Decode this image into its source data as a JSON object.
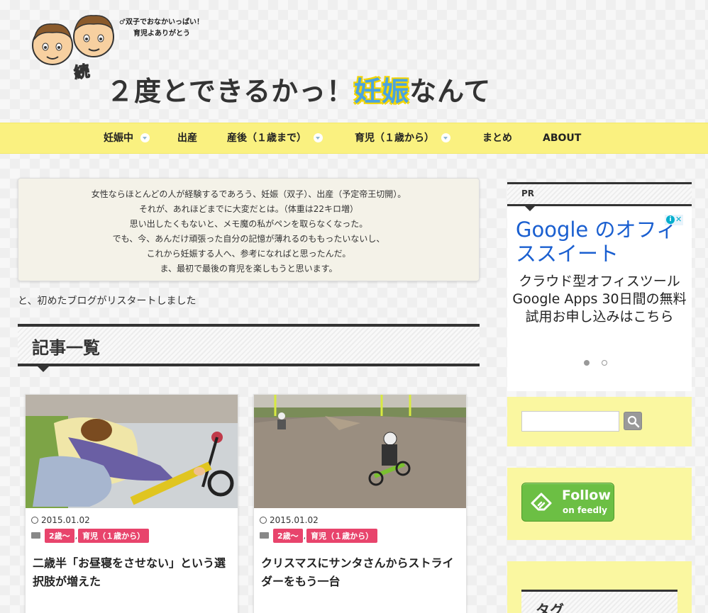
{
  "header": {
    "tagline_line1": "♂双子でおなかいっぱい！",
    "tagline_line2": "育児よありがとう",
    "zoku": "続",
    "title_part1": "２度とできるかっ！",
    "title_highlight_1": "妊",
    "title_highlight_2": "娠",
    "title_part2": "なんて"
  },
  "nav": {
    "items": [
      {
        "label": "妊娠中",
        "has_dropdown": true
      },
      {
        "label": "出産",
        "has_dropdown": false
      },
      {
        "label": "産後（１歳まで）",
        "has_dropdown": true
      },
      {
        "label": "育児（１歳から）",
        "has_dropdown": true
      },
      {
        "label": "まとめ",
        "has_dropdown": false
      },
      {
        "label": "ABOUT",
        "has_dropdown": false
      }
    ]
  },
  "intro": {
    "lines": [
      "女性ならほとんどの人が経験するであろう、妊娠（双子）、出産（予定帝王切開）。",
      "それが、あれほどまでに大変だとは。（体重は22キロ増）",
      "思い出したくもないと、メモ魔の私がペンを取らなくなった。",
      "でも、今、あんだけ頑張った自分の記憶が薄れるのももったいないし、",
      "これから妊娠する人へ、参考になればと思ったんだ。",
      "ま、最初で最後の育児を楽しもうと思います。"
    ],
    "after_text": "と、初めたブログがリスタートしました"
  },
  "section": {
    "heading": "記事一覧"
  },
  "posts": [
    {
      "date": "2015.01.02",
      "categories": [
        "2歳～",
        "育児（１歳から）"
      ],
      "title": "二歳半「お昼寝をさせない」という選択肢が増えた"
    },
    {
      "date": "2015.01.02",
      "categories": [
        "2歳～",
        "育児（１歳から）"
      ],
      "title": "クリスマスにサンタさんからストライダーをもう一台"
    }
  ],
  "sidebar": {
    "pr_label": "PR",
    "ad": {
      "title": "Google のオフィススイート",
      "body": "クラウド型オフィスツール Google Apps 30日間の無料試用お申し込みはこちら",
      "badge_close": "✕",
      "badge_info": "i"
    },
    "search": {
      "placeholder": ""
    },
    "feedly": {
      "line1": "Follow",
      "line2": "on feedly"
    },
    "tag_heading": "タグ"
  },
  "colors": {
    "nav_bg": "#faf180",
    "category_badge": "#e8446c",
    "feedly_green": "#6cbf44",
    "ad_link": "#1a5fd0"
  }
}
